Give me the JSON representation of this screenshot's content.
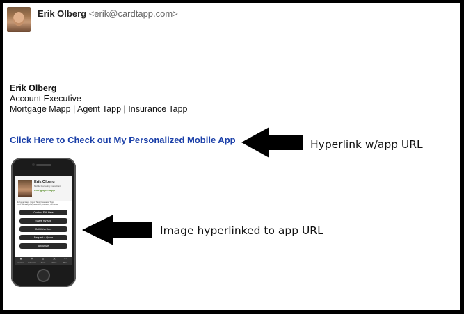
{
  "sender": {
    "name": "Erik Olberg",
    "email": "<erik@cardtapp.com>"
  },
  "signature": {
    "name": "Erik Olberg",
    "title": "Account Executive",
    "products": "Mortgage Mapp | Agent Tapp | Insurance Tapp"
  },
  "link_text": "Click Here to Check out My Personalized Mobile App",
  "annotations": {
    "hyperlink": "Hyperlink w/app URL",
    "image": "Image hyperlinked to app URL"
  },
  "phone": {
    "name": "Erik Olberg",
    "title": "Mobile Marketing Consultant",
    "logo": "mortgage mapp",
    "info": [
      "Mortgage Mapp | Agent Tapp | Insurance Tapp",
      "1234 Seminary Ave, Suite 400 | Oakland, CA 94611"
    ],
    "buttons": [
      "Contact Erik Here",
      "Share my App",
      "Call John Here",
      "Request a Quote",
      "About Me"
    ],
    "tabs": [
      {
        "icon": "●",
        "label": "Contact"
      },
      {
        "icon": "+",
        "label": "Calculator"
      },
      {
        "icon": "≡",
        "label": "News"
      },
      {
        "icon": "✕",
        "label": "Rates"
      },
      {
        "icon": "⋯",
        "label": "More"
      }
    ]
  }
}
